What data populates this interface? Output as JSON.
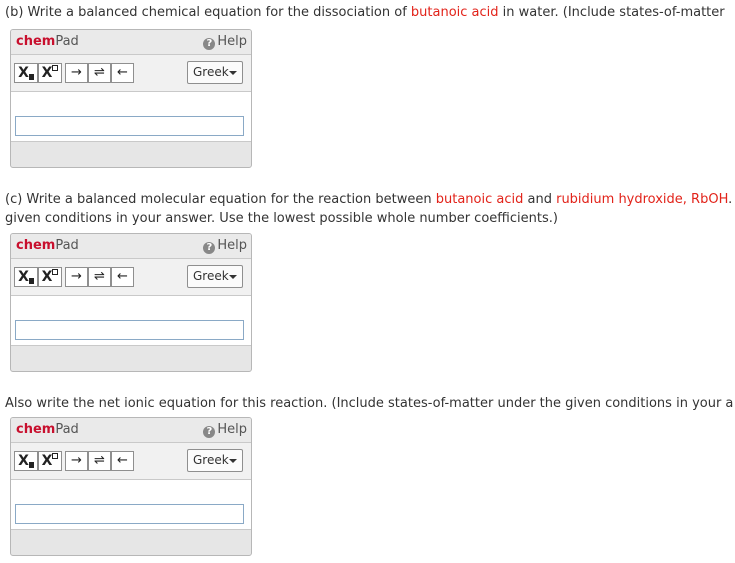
{
  "questions": [
    {
      "segments": [
        {
          "text": "(b) Write a balanced chemical equation for the dissociation of ",
          "hl": false
        },
        {
          "text": "butanoic acid",
          "hl": true
        },
        {
          "text": " in water. (Include states-of-matter",
          "hl": false
        }
      ]
    },
    {
      "segments": [
        {
          "text": "(c) Write a balanced molecular equation for the reaction between ",
          "hl": false
        },
        {
          "text": "butanoic acid",
          "hl": true
        },
        {
          "text": " and ",
          "hl": false
        },
        {
          "text": "rubidium hydroxide, RbOH",
          "hl": true
        },
        {
          "text": ". ",
          "hl": false
        }
      ],
      "line2": "given conditions in your answer. Use the lowest possible whole number coefficients.)"
    },
    {
      "segments": [
        {
          "text": "Also write the net ionic equation for this reaction. (Include states-of-matter under the given conditions in your a",
          "hl": false
        }
      ]
    }
  ],
  "chempad": {
    "title_chem": "chem",
    "title_pad": "Pad",
    "help_label": "Help",
    "help_icon": "?",
    "subscript_label": "X",
    "superscript_label": "X",
    "arrow_symbol": "→",
    "equilibrium_symbol": "⇌",
    "left_arrow_symbol": "←",
    "greek_label": "Greek"
  },
  "colors": {
    "highlight": "#e2231a",
    "brand": "#c8102e"
  }
}
